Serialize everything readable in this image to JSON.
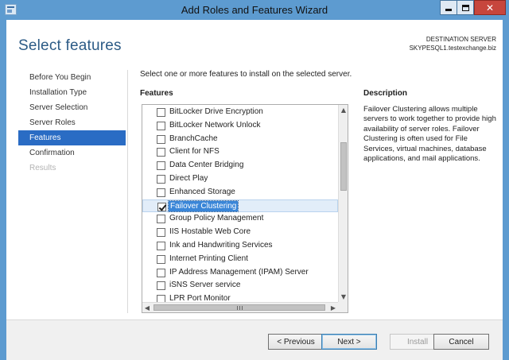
{
  "window": {
    "title": "Add Roles and Features Wizard",
    "close_glyph": "✕"
  },
  "header": {
    "page_title": "Select features",
    "destination_label": "DESTINATION SERVER",
    "destination_server": "SKYPESQL1.testexchange.biz"
  },
  "nav": {
    "items": [
      {
        "label": "Before You Begin",
        "state": "normal"
      },
      {
        "label": "Installation Type",
        "state": "normal"
      },
      {
        "label": "Server Selection",
        "state": "normal"
      },
      {
        "label": "Server Roles",
        "state": "normal"
      },
      {
        "label": "Features",
        "state": "active"
      },
      {
        "label": "Confirmation",
        "state": "normal"
      },
      {
        "label": "Results",
        "state": "disabled"
      }
    ]
  },
  "main": {
    "instruction": "Select one or more features to install on the selected server.",
    "features_heading": "Features",
    "features": [
      {
        "label": "BitLocker Drive Encryption",
        "checked": false,
        "selected": false
      },
      {
        "label": "BitLocker Network Unlock",
        "checked": false,
        "selected": false
      },
      {
        "label": "BranchCache",
        "checked": false,
        "selected": false
      },
      {
        "label": "Client for NFS",
        "checked": false,
        "selected": false
      },
      {
        "label": "Data Center Bridging",
        "checked": false,
        "selected": false
      },
      {
        "label": "Direct Play",
        "checked": false,
        "selected": false
      },
      {
        "label": "Enhanced Storage",
        "checked": false,
        "selected": false
      },
      {
        "label": "Failover Clustering",
        "checked": true,
        "selected": true
      },
      {
        "label": "Group Policy Management",
        "checked": false,
        "selected": false
      },
      {
        "label": "IIS Hostable Web Core",
        "checked": false,
        "selected": false
      },
      {
        "label": "Ink and Handwriting Services",
        "checked": false,
        "selected": false
      },
      {
        "label": "Internet Printing Client",
        "checked": false,
        "selected": false
      },
      {
        "label": "IP Address Management (IPAM) Server",
        "checked": false,
        "selected": false
      },
      {
        "label": "iSNS Server service",
        "checked": false,
        "selected": false
      },
      {
        "label": "LPR Port Monitor",
        "checked": false,
        "selected": false
      }
    ],
    "scroll_arrows": {
      "up": "▲",
      "down": "▼",
      "left": "◀",
      "right": "▶"
    }
  },
  "description": {
    "heading": "Description",
    "text": "Failover Clustering allows multiple servers to work together to provide high availability of server roles. Failover Clustering is often used for File Services, virtual machines, database applications, and mail applications."
  },
  "footer": {
    "previous": "< Previous",
    "next": "Next >",
    "install": "Install",
    "cancel": "Cancel"
  },
  "colors": {
    "title_bar": "#5d9bd0",
    "active_nav": "#2a6cc4",
    "selection": "#3a86d8",
    "page_title": "#2c5b86",
    "close_button": "#c7463d"
  }
}
